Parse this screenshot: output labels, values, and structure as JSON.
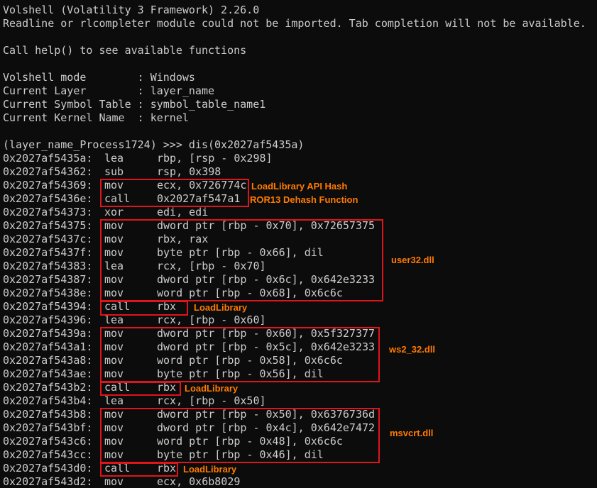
{
  "colors": {
    "background": "#0c0c0c",
    "text": "#cccccc",
    "box": "#e0141b",
    "annotation": "#ff7a00"
  },
  "header": {
    "banner": "Volshell (Volatility 3 Framework) 2.26.0",
    "readline_warning": "Readline or rlcompleter module could not be imported. Tab completion will not be available.",
    "help_hint": "Call help() to see available functions",
    "mode_line": "Volshell mode        : Windows",
    "layer_line": "Current Layer        : layer_name",
    "symbol_line": "Current Symbol Table : symbol_table_name1",
    "kernel_line": "Current Kernel Name  : kernel"
  },
  "command": "(layer_name_Process1724) >>> dis(0x2027af5435a)",
  "instructions": [
    {
      "addr": "0x2027af5435a:",
      "mnemonic": "lea",
      "operands": "rbp, [rsp - 0x298]"
    },
    {
      "addr": "0x2027af54362:",
      "mnemonic": "sub",
      "operands": "rsp, 0x398"
    },
    {
      "addr": "0x2027af54369:",
      "mnemonic": "mov",
      "operands": "ecx, 0x726774c"
    },
    {
      "addr": "0x2027af5436e:",
      "mnemonic": "call",
      "operands": "0x2027af547a1"
    },
    {
      "addr": "0x2027af54373:",
      "mnemonic": "xor",
      "operands": "edi, edi"
    },
    {
      "addr": "0x2027af54375:",
      "mnemonic": "mov",
      "operands": "dword ptr [rbp - 0x70], 0x72657375"
    },
    {
      "addr": "0x2027af5437c:",
      "mnemonic": "mov",
      "operands": "rbx, rax"
    },
    {
      "addr": "0x2027af5437f:",
      "mnemonic": "mov",
      "operands": "byte ptr [rbp - 0x66], dil"
    },
    {
      "addr": "0x2027af54383:",
      "mnemonic": "lea",
      "operands": "rcx, [rbp - 0x70]"
    },
    {
      "addr": "0x2027af54387:",
      "mnemonic": "mov",
      "operands": "dword ptr [rbp - 0x6c], 0x642e3233"
    },
    {
      "addr": "0x2027af5438e:",
      "mnemonic": "mov",
      "operands": "word ptr [rbp - 0x68], 0x6c6c"
    },
    {
      "addr": "0x2027af54394:",
      "mnemonic": "call",
      "operands": "rbx"
    },
    {
      "addr": "0x2027af54396:",
      "mnemonic": "lea",
      "operands": "rcx, [rbp - 0x60]"
    },
    {
      "addr": "0x2027af5439a:",
      "mnemonic": "mov",
      "operands": "dword ptr [rbp - 0x60], 0x5f327377"
    },
    {
      "addr": "0x2027af543a1:",
      "mnemonic": "mov",
      "operands": "dword ptr [rbp - 0x5c], 0x642e3233"
    },
    {
      "addr": "0x2027af543a8:",
      "mnemonic": "mov",
      "operands": "word ptr [rbp - 0x58], 0x6c6c"
    },
    {
      "addr": "0x2027af543ae:",
      "mnemonic": "mov",
      "operands": "byte ptr [rbp - 0x56], dil"
    },
    {
      "addr": "0x2027af543b2:",
      "mnemonic": "call",
      "operands": "rbx"
    },
    {
      "addr": "0x2027af543b4:",
      "mnemonic": "lea",
      "operands": "rcx, [rbp - 0x50]"
    },
    {
      "addr": "0x2027af543b8:",
      "mnemonic": "mov",
      "operands": "dword ptr [rbp - 0x50], 0x6376736d"
    },
    {
      "addr": "0x2027af543bf:",
      "mnemonic": "mov",
      "operands": "dword ptr [rbp - 0x4c], 0x642e7472"
    },
    {
      "addr": "0x2027af543c6:",
      "mnemonic": "mov",
      "operands": "word ptr [rbp - 0x48], 0x6c6c"
    },
    {
      "addr": "0x2027af543cc:",
      "mnemonic": "mov",
      "operands": "byte ptr [rbp - 0x46], dil"
    },
    {
      "addr": "0x2027af543d0:",
      "mnemonic": "call",
      "operands": "rbx"
    },
    {
      "addr": "0x2027af543d2:",
      "mnemonic": "mov",
      "operands": "ecx, 0x6b8029"
    }
  ],
  "annotations": {
    "api_hash": "LoadLibrary API Hash",
    "dehash": "ROR13 Dehash Function",
    "user32": "user32.dll",
    "loadlib_1": "LoadLibrary",
    "ws2_32": "ws2_32.dll",
    "loadlib_2": "LoadLibrary",
    "msvcrt": "msvcrt.dll",
    "loadlib_3": "LoadLibrary"
  }
}
